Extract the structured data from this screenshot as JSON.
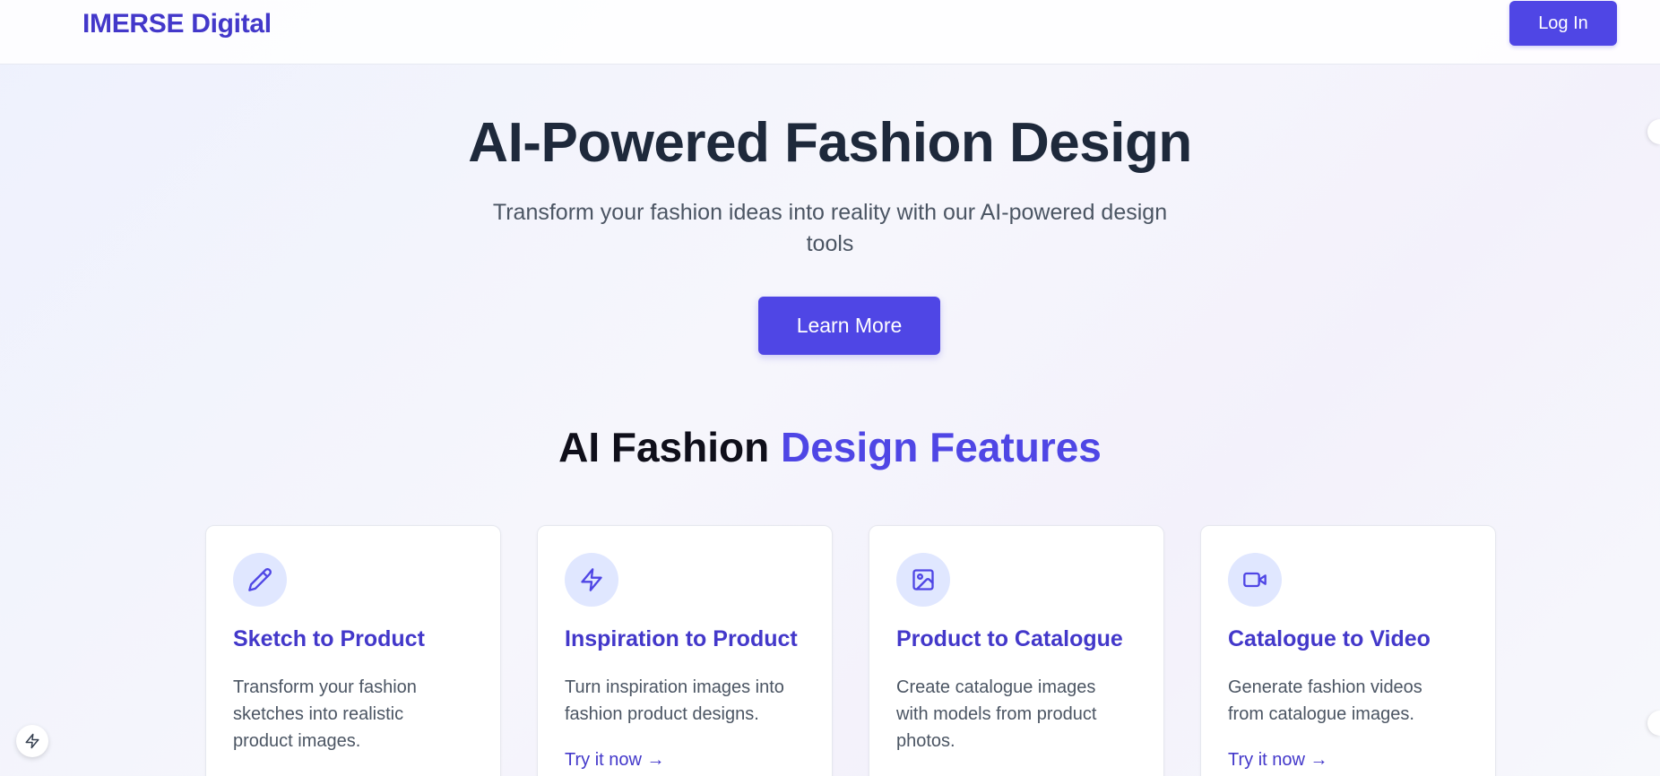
{
  "header": {
    "brand": "IMERSE Digital",
    "login_label": "Log In"
  },
  "hero": {
    "title": "AI-Powered Fashion Design",
    "subtitle": "Transform your fashion ideas into reality with our AI-powered design tools",
    "cta_label": "Learn More"
  },
  "features": {
    "title_plain": "AI Fashion",
    "title_accent": "Design Features",
    "cards": [
      {
        "icon": "pencil-icon",
        "title": "Sketch to Product",
        "description": "Transform your fashion sketches into realistic product images.",
        "link": ""
      },
      {
        "icon": "bolt-icon",
        "title": "Inspiration to Product",
        "description": "Turn inspiration images into fashion product designs.",
        "link": "Try it now →"
      },
      {
        "icon": "image-icon",
        "title": "Product to Catalogue",
        "description": "Create catalogue images with models from product photos.",
        "link": ""
      },
      {
        "icon": "video-icon",
        "title": "Catalogue to Video",
        "description": "Generate fashion videos from catalogue images.",
        "link": "Try it now →"
      }
    ]
  },
  "colors": {
    "accent": "#4f46e5",
    "accent_dark": "#4338ca",
    "icon_bg": "#e0e7ff",
    "heading": "#1e293b",
    "body_text": "#4b5563"
  },
  "floating_widget": {
    "icon": "bolt-icon"
  }
}
